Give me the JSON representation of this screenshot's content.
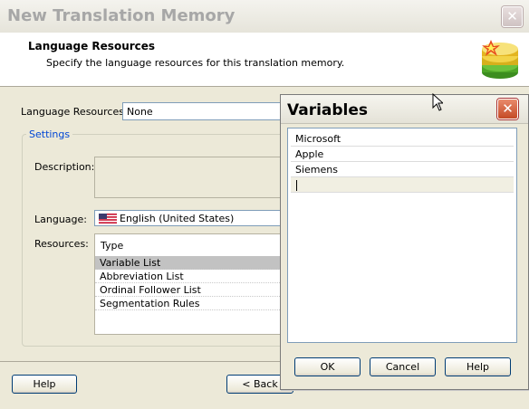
{
  "main": {
    "title": "New Translation Memory",
    "header": {
      "title": "Language Resources",
      "subtitle": "Specify the language resources for this translation memory."
    },
    "language_resources_label": "Language Resources:",
    "language_resources_value": "None",
    "settings_legend": "Settings",
    "description_label": "Description:",
    "language_label": "Language:",
    "language_value": "English (United States)",
    "resources_label": "Resources:",
    "resources_header": "Type",
    "resources": [
      {
        "label": "Variable List",
        "selected": true
      },
      {
        "label": "Abbreviation List",
        "selected": false
      },
      {
        "label": "Ordinal Follower List",
        "selected": false
      },
      {
        "label": "Segmentation Rules",
        "selected": false
      }
    ],
    "buttons": {
      "help": "Help",
      "back": "< Back"
    }
  },
  "variables_dialog": {
    "title": "Variables",
    "items": [
      "Microsoft",
      "Apple",
      "Siemens",
      ""
    ],
    "buttons": {
      "ok": "OK",
      "cancel": "Cancel",
      "help": "Help"
    }
  },
  "colors": {
    "window_bg": "#ece9d8",
    "close_red": "#c44a26",
    "selection_gray": "#c2c2c2",
    "group_legend": "#0046d5"
  }
}
